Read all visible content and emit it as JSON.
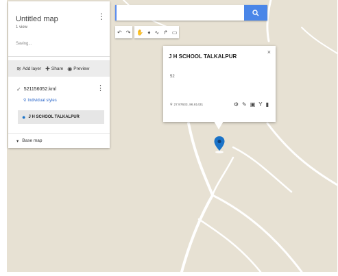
{
  "map": {
    "title": "Untitled map",
    "subtitle": "1 view",
    "saving_status": "Saving...",
    "toolbar": {
      "add_layer": "Add layer",
      "share": "Share",
      "preview": "Preview"
    },
    "layer": {
      "name": "521156052.kml",
      "style_link": "Individual styles",
      "place": "J H SCHOOL TALKALPUR"
    },
    "base_map_label": "Base map"
  },
  "search": {
    "value": "",
    "placeholder": ""
  },
  "tools": [
    "undo-icon",
    "redo-icon",
    "hand-icon",
    "marker-icon",
    "line-icon",
    "directions-icon",
    "ruler-icon"
  ],
  "info_window": {
    "title": "J H SCHOOL TALKALPUR",
    "description": "52",
    "coordinates": "27.97633, 86.81431"
  },
  "colors": {
    "map_background": "#e7e1d3",
    "road": "#ffffff",
    "accent_blue": "#4a86e8",
    "marker_blue": "#1a73c8"
  }
}
